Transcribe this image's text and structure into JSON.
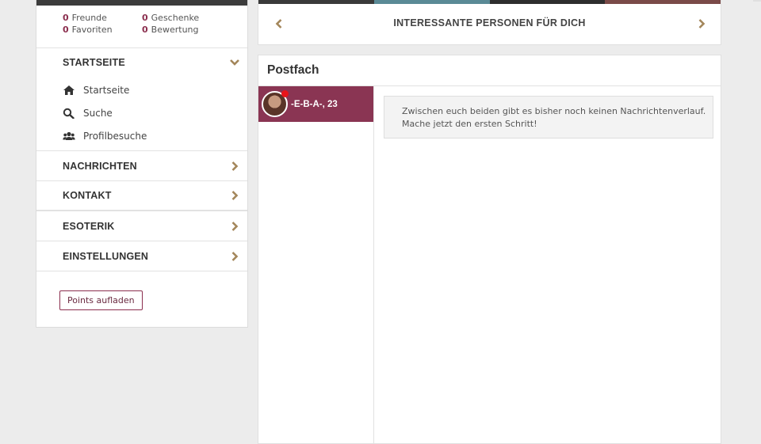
{
  "sidebar": {
    "stats": [
      {
        "count": "0",
        "label": "Freunde"
      },
      {
        "count": "0",
        "label": "Geschenke"
      },
      {
        "count": "0",
        "label": "Favoriten"
      },
      {
        "count": "0",
        "label": "Bewertung"
      }
    ],
    "sections": {
      "startseite": {
        "label": "STARTSEITE",
        "expanded": true,
        "items": [
          {
            "label": "Startseite",
            "icon": "home-icon"
          },
          {
            "label": "Suche",
            "icon": "search-icon"
          },
          {
            "label": "Profilbesuche",
            "icon": "users-icon"
          }
        ]
      },
      "nachrichten": {
        "label": "NACHRICHTEN"
      },
      "kontakt": {
        "label": "KONTAKT"
      },
      "esoterik": {
        "label": "ESOTERIK"
      },
      "einstellungen": {
        "label": "EINSTELLUNGEN"
      }
    },
    "points_button": "Points aufladen"
  },
  "banner": {
    "title": "INTERESSANTE PERSONEN FÜR DICH"
  },
  "postfach": {
    "title": "Postfach",
    "conversations": [
      {
        "name": "-E-B-A-, 23",
        "online": true
      }
    ],
    "empty_message_line1": "Zwischen euch beiden gibt es bisher noch keinen Nachrichtenverlauf.",
    "empty_message_line2": "Mache jetzt den ersten Schritt!"
  },
  "colors": {
    "accent": "#8a3553",
    "gold": "#a3865a",
    "online_dot": "#e8141a"
  }
}
